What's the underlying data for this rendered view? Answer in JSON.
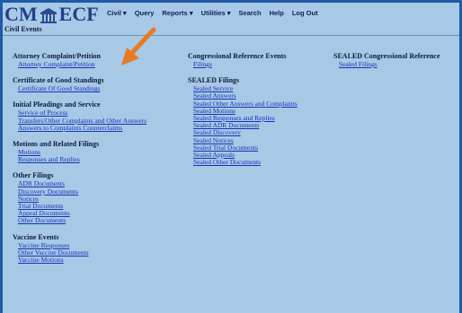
{
  "header": {
    "logo_left": "CM",
    "logo_right": "ECF",
    "menu": [
      {
        "label": "Civil",
        "dropdown": true
      },
      {
        "label": "Query",
        "dropdown": false
      },
      {
        "label": "Reports",
        "dropdown": true
      },
      {
        "label": "Utilities",
        "dropdown": true
      },
      {
        "label": "Search",
        "dropdown": false
      },
      {
        "label": "Help",
        "dropdown": false
      },
      {
        "label": "Log Out",
        "dropdown": false
      }
    ]
  },
  "page_title": "Civil Events",
  "colors": {
    "background": "#a7c9e6",
    "border": "#1f5aa6",
    "link": "#1a2fb8",
    "arrow": "#e87a24"
  },
  "columns": [
    {
      "groups": [
        {
          "title": "Attorney Complaint/Petition",
          "links": [
            "Attorney Complaint/Petition"
          ]
        },
        {
          "title": "Certificate of Good Standings",
          "links": [
            "Certificate Of Good Standings"
          ]
        },
        {
          "title": "Initial Pleadings and Service",
          "links": [
            "Service of Process",
            "Transfers/Other Complaints and Other Answers",
            "Answers to Complaints Counterclaims"
          ]
        },
        {
          "title": "Motions and Related Filings",
          "links": [
            "Motions",
            "Responses and Replies"
          ]
        },
        {
          "title": "Other Filings",
          "links": [
            "ADR Documents",
            "Discovery Documents",
            "Notices",
            "Trial Documents",
            "Appeal Documents",
            "Other Documents"
          ]
        },
        {
          "title": "Vaccine Events",
          "links": [
            "Vaccine Responses",
            "Other Vaccine Documents",
            "Vaccine Motions"
          ]
        }
      ]
    },
    {
      "groups": [
        {
          "title": "Congressional Reference Events",
          "links": [
            "Filings"
          ]
        },
        {
          "title": "SEALED Filings",
          "links": [
            "Sealed Service",
            "Sealed Answers",
            "Sealed Other Answers and Complaints",
            "Sealed Motions",
            "Sealed Responses and Replies",
            "Sealed ADR Documents",
            "Sealed Discovery",
            "Sealed Notices",
            "Sealed Trial Documents",
            "Sealed Appeals",
            "Sealed Other Documents"
          ]
        }
      ]
    },
    {
      "groups": [
        {
          "title": "SEALED Congressional Reference",
          "links": [
            "Sealed Filings"
          ]
        }
      ]
    }
  ]
}
